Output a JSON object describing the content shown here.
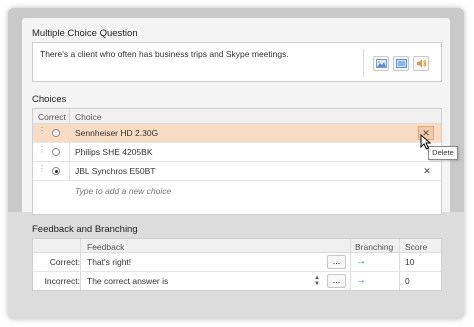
{
  "question": {
    "title": "Multiple Choice Question",
    "text": "There's a client who often has business trips and Skype meetings.",
    "media_icons": [
      "image-icon",
      "video-icon",
      "audio-icon"
    ]
  },
  "choices": {
    "title": "Choices",
    "col_correct": "Correct",
    "col_choice": "Choice",
    "rows": [
      {
        "label": "Sennheiser HD 2.30G",
        "selected": false
      },
      {
        "label": "Philips SHE 4205BK",
        "selected": false
      },
      {
        "label": "JBL Synchros E50BT",
        "selected": true
      }
    ],
    "new_placeholder": "Type to add a new choice",
    "delete_tooltip": "Delete"
  },
  "feedback": {
    "title": "Feedback and Branching",
    "col_feedback": "Feedback",
    "col_branching": "Branching",
    "col_score": "Score",
    "rows": [
      {
        "label": "Correct:",
        "text": "That's right!",
        "score": "10"
      },
      {
        "label": "Incorrect:",
        "text": "The correct answer is",
        "score": "0"
      }
    ],
    "more_label": "...",
    "branch_icon": "→"
  },
  "colors": {
    "highlight_row": "#f9dcc4",
    "accent_arrow": "#1f6fbf"
  }
}
